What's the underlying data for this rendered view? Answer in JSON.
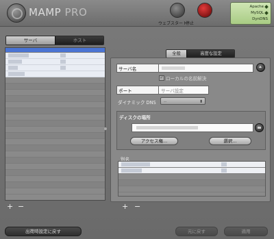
{
  "app": {
    "name": "MAMP",
    "edition": "PRO"
  },
  "toolbar": {
    "webstart_label": "ウェブスタート",
    "stop_label": "停止"
  },
  "status": {
    "items": [
      "Apache",
      "MySQL",
      "DynDNS"
    ]
  },
  "left": {
    "tabs": [
      "サーバ",
      "ホスト"
    ]
  },
  "right": {
    "tabs": [
      "全般",
      "高度な設定"
    ],
    "server_name_label": "サーバ名",
    "local_resolve_label": "ローカルの名前解決",
    "port_label": "ポート",
    "port_value": "サーバ設定",
    "dyndns_label": "ダイナミック DNS",
    "dyndns_value": "--",
    "disk_label": "ディスクの場所",
    "access_button": "アクセス権...",
    "select_button": "選択...",
    "alias_label": "別名"
  },
  "footer": {
    "reset_button": "出荷時設定に戻す",
    "revert_button": "元に戻す",
    "apply_button": "適用"
  }
}
